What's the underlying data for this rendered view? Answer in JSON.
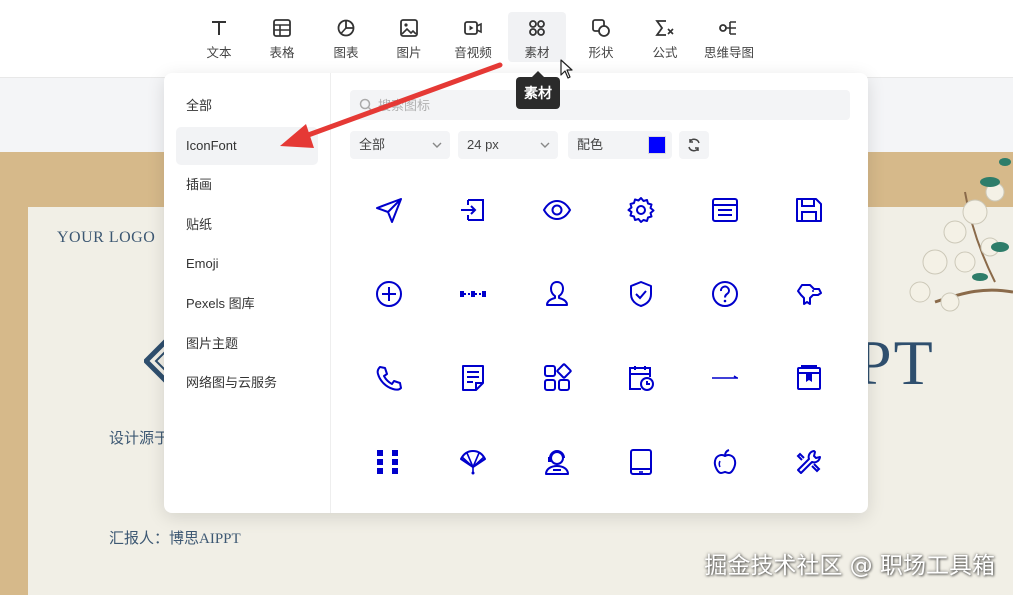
{
  "toolbar": {
    "items": [
      {
        "label": "文本",
        "icon": "text-icon"
      },
      {
        "label": "表格",
        "icon": "table-icon"
      },
      {
        "label": "图表",
        "icon": "chart-icon"
      },
      {
        "label": "图片",
        "icon": "image-icon"
      },
      {
        "label": "音视频",
        "icon": "video-icon"
      },
      {
        "label": "素材",
        "icon": "assets-icon",
        "active": true
      },
      {
        "label": "形状",
        "icon": "shape-icon"
      },
      {
        "label": "公式",
        "icon": "formula-icon"
      },
      {
        "label": "思维导图",
        "icon": "mindmap-icon"
      }
    ]
  },
  "tooltip": "素材",
  "sidebar": {
    "items": [
      {
        "label": "全部"
      },
      {
        "label": "IconFont",
        "active": true
      },
      {
        "label": "插画"
      },
      {
        "label": "贴纸"
      },
      {
        "label": "Emoji"
      },
      {
        "label": "Pexels 图库"
      },
      {
        "label": "图片主题"
      },
      {
        "label": "网络图与云服务"
      }
    ]
  },
  "search": {
    "placeholder": "搜索图标"
  },
  "filters": {
    "category": "全部",
    "size": "24 px",
    "color_label": "配色",
    "color_value": "#0000ff"
  },
  "icons": [
    "send-icon",
    "login-icon",
    "eye-icon",
    "gear-icon",
    "document-list-icon",
    "save-icon",
    "plus-circle-icon",
    "dotted-line-icon",
    "user-icon",
    "shield-check-icon",
    "question-circle-icon",
    "dog-icon",
    "phone-icon",
    "note-icon",
    "apps-icon",
    "calendar-clock-icon",
    "arrow-right-icon",
    "bookmark-book-icon",
    "grid-dots-icon",
    "fan-icon",
    "customer-service-icon",
    "tablet-icon",
    "apple-icon",
    "wrench-icon"
  ],
  "slide": {
    "logo": "YOUR LOGO",
    "title_fragment": "PT",
    "subtitle_fragment": "设计源于",
    "reporter": "汇报人：博思AIPPT"
  },
  "watermark": "掘金技术社区 @ 职场工具箱",
  "colors": {
    "accent": "#0000ff",
    "arrow": "#e53935"
  }
}
